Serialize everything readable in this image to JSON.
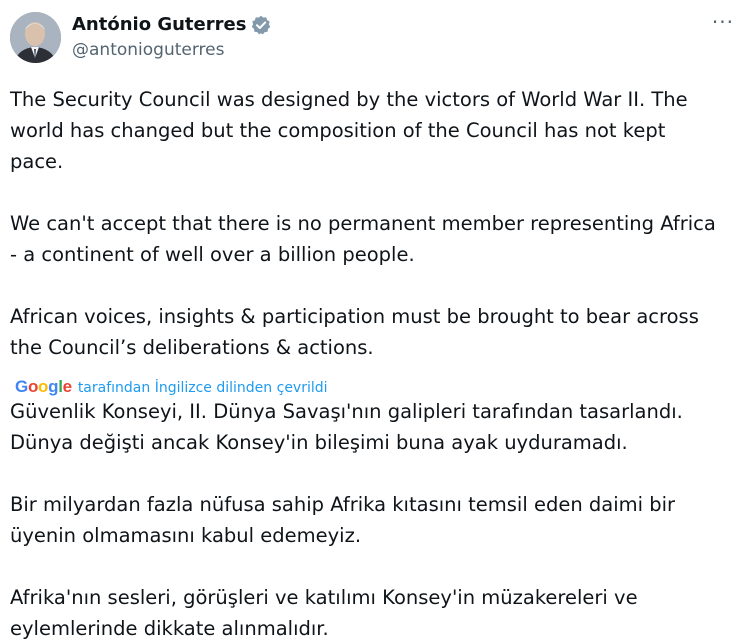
{
  "author": {
    "display_name": "António Guterres",
    "handle": "@antonioguterres"
  },
  "colors": {
    "verified_badge": "#829aab",
    "link": "#1d9bf0"
  },
  "icons": {
    "verified": "verified-badge-icon",
    "more": "more-options-icon"
  },
  "more_glyph": "···",
  "original": {
    "p1": "The Security Council was designed by the victors of World War II. The\nworld has changed but the composition of the Council has not kept\npace.",
    "p2": "We can't accept that there is no permanent member representing Africa\n- a continent of well over a billion people.",
    "p3": "African voices, insights & participation must be brought to bear across\nthe Council’s deliberations & actions."
  },
  "translation": {
    "brand": "Google",
    "note": "tarafından İngilizce dilinden çevrildi",
    "p1": "Güvenlik Konseyi, II. Dünya Savaşı'nın galipleri tarafından tasarlandı.\nDünya değişti ancak Konsey'in bileşimi buna ayak uyduramadı.",
    "p2": "Bir milyardan fazla nüfusa sahip Afrika kıtasını temsil eden daimi bir\nüyenin olmamasını kabul edemeyiz.",
    "p3": "Afrika'nın sesleri, görüşleri ve katılımı Konsey'in müzakereleri ve\neylemlerinde dikkate alınmalıdır."
  }
}
